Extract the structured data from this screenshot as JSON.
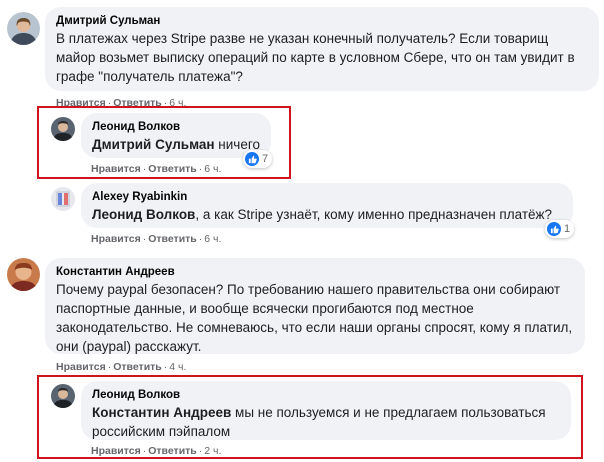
{
  "comments": [
    {
      "author": "Дмитрий Сульман",
      "text": "В платежах через Stripe разве не указан конечный получатель? Если товарищ майор возьмет выписку операций по карте в условном Сбере, что он там увидит в графе \"получатель платежа\"?",
      "like": "Нравится",
      "reply": "Ответить",
      "time": "6 ч."
    },
    {
      "author": "Леонид Волков",
      "mention": "Дмитрий Сульман",
      "text": " ничего",
      "like": "Нравится",
      "reply": "Ответить",
      "time": "6 ч.",
      "reactions": "7"
    },
    {
      "author": "Alexey Ryabinkin",
      "mention": "Леонид Волков",
      "text": ", а как Stripe узнаёт, кому именно предназначен платёж?",
      "like": "Нравится",
      "reply": "Ответить",
      "time": "6 ч.",
      "reactions": "1"
    },
    {
      "author": "Константин Андреев",
      "text": "Почему paypal безопасен? По требованию нашего правительства они собирают паспортные данные, и вообще всячески прогибаются под местное законодательство. Не сомневаюсь, что если наши органы спросят, кому я платил, они (paypal) расскажут.",
      "like": "Нравится",
      "reply": "Ответить",
      "time": "4 ч."
    },
    {
      "author": "Леонид Волков",
      "mention": "Константин Андреев",
      "text": " мы не пользуемся и не предлагаем пользоваться российским пэйпалом",
      "like": "Нравится",
      "reply": "Ответить",
      "time": "2 ч."
    }
  ],
  "separator": "·",
  "colors": {
    "bubble": "#f0f2f5",
    "highlight_box": "#d0141c",
    "like_blue": "#1877f2",
    "meta_text": "#65676b"
  },
  "icons": [
    "avatar",
    "thumbs-up-icon"
  ]
}
